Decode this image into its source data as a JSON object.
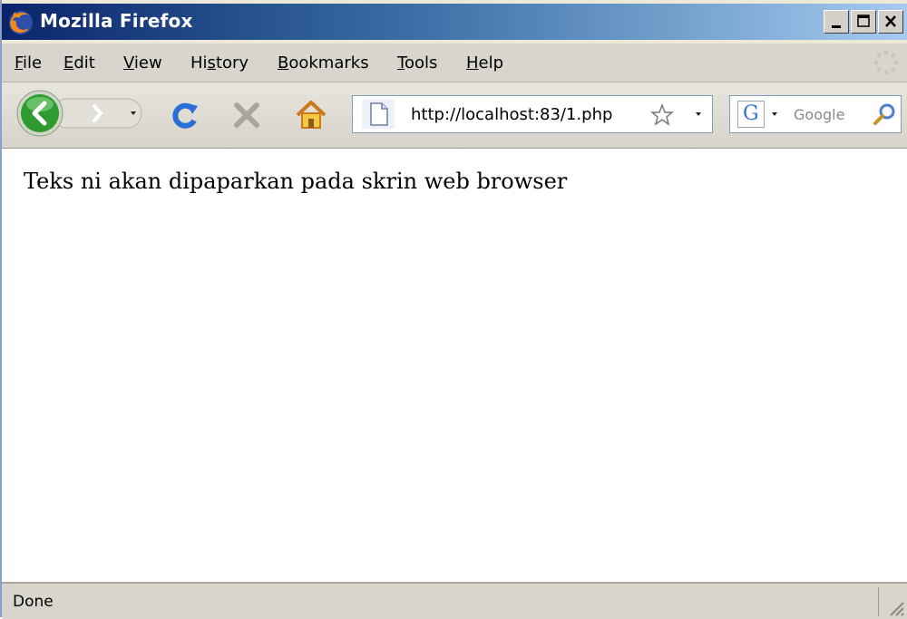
{
  "window": {
    "title": "Mozilla Firefox"
  },
  "menu": {
    "items": [
      {
        "label": "File",
        "key": "F"
      },
      {
        "label": "Edit",
        "key": "E"
      },
      {
        "label": "View",
        "key": "V"
      },
      {
        "label": "History",
        "key": "s"
      },
      {
        "label": "Bookmarks",
        "key": "B"
      },
      {
        "label": "Tools",
        "key": "T"
      },
      {
        "label": "Help",
        "key": "H"
      }
    ]
  },
  "toolbar": {
    "url": "http://localhost:83/1.php",
    "search_engine": "G",
    "search_placeholder": "Google"
  },
  "page": {
    "text": "Teks ni akan dipaparkan pada skrin web browser"
  },
  "status": {
    "text": "Done"
  },
  "colors": {
    "title_gradient_start": "#0a246a",
    "title_gradient_end": "#a6caf0",
    "back_button_green": "#2f9a2f",
    "reload_blue": "#2a6fd6"
  },
  "icons": [
    "firefox-logo-icon",
    "minimize-icon",
    "maximize-icon",
    "close-icon",
    "throbber-icon",
    "back-icon",
    "forward-icon",
    "history-dropdown-icon",
    "reload-icon",
    "stop-icon",
    "home-icon",
    "page-icon",
    "bookmark-star-icon",
    "url-dropdown-icon",
    "search-engine-icon",
    "search-icon",
    "resize-grip-icon"
  ]
}
